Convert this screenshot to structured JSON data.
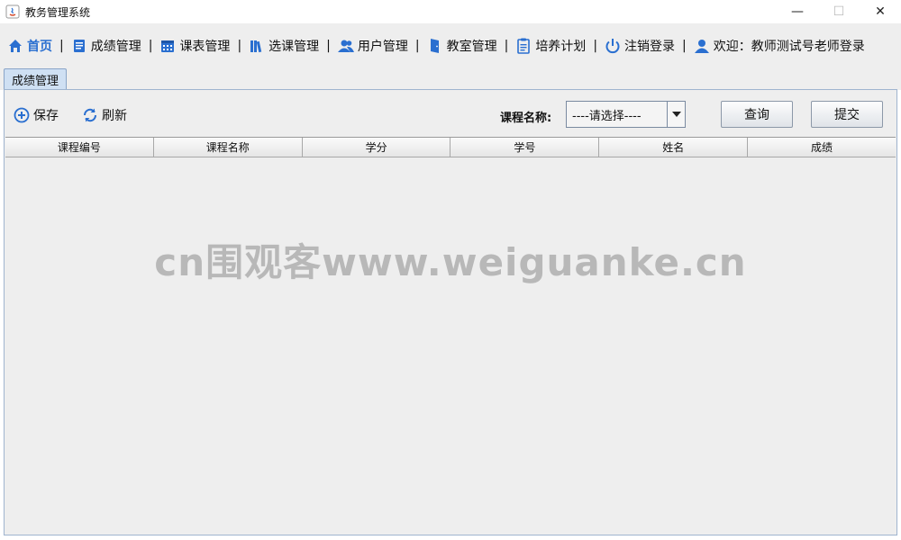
{
  "window": {
    "title": "教务管理系统",
    "controls": {
      "minimize": "—",
      "maximize": "☐",
      "close": "✕"
    }
  },
  "menu": {
    "items": [
      {
        "label": "首页",
        "icon": "home-icon"
      },
      {
        "label": "成绩管理",
        "icon": "document-icon"
      },
      {
        "label": "课表管理",
        "icon": "calendar-icon"
      },
      {
        "label": "选课管理",
        "icon": "books-icon"
      },
      {
        "label": "用户管理",
        "icon": "users-icon"
      },
      {
        "label": "教室管理",
        "icon": "door-icon"
      },
      {
        "label": "培养计划",
        "icon": "clipboard-icon"
      },
      {
        "label": "注销登录",
        "icon": "power-icon"
      }
    ],
    "separator": "|",
    "welcome": "欢迎：教师测试号老师登录"
  },
  "tabs": [
    {
      "label": "成绩管理",
      "active": true
    }
  ],
  "toolbar": {
    "save_label": "保存",
    "refresh_label": "刷新",
    "course_label": "课程名称:",
    "course_select_value": "----请选择----",
    "query_label": "查询",
    "submit_label": "提交"
  },
  "table": {
    "columns": [
      "课程编号",
      "课程名称",
      "学分",
      "学号",
      "姓名",
      "成绩"
    ],
    "rows": []
  },
  "watermark": "cn围观客www.weiguanke.cn",
  "colors": {
    "accent": "#2a6fd0",
    "menu_bg": "#eeeeee",
    "tab_active": "#cfe0f3"
  }
}
